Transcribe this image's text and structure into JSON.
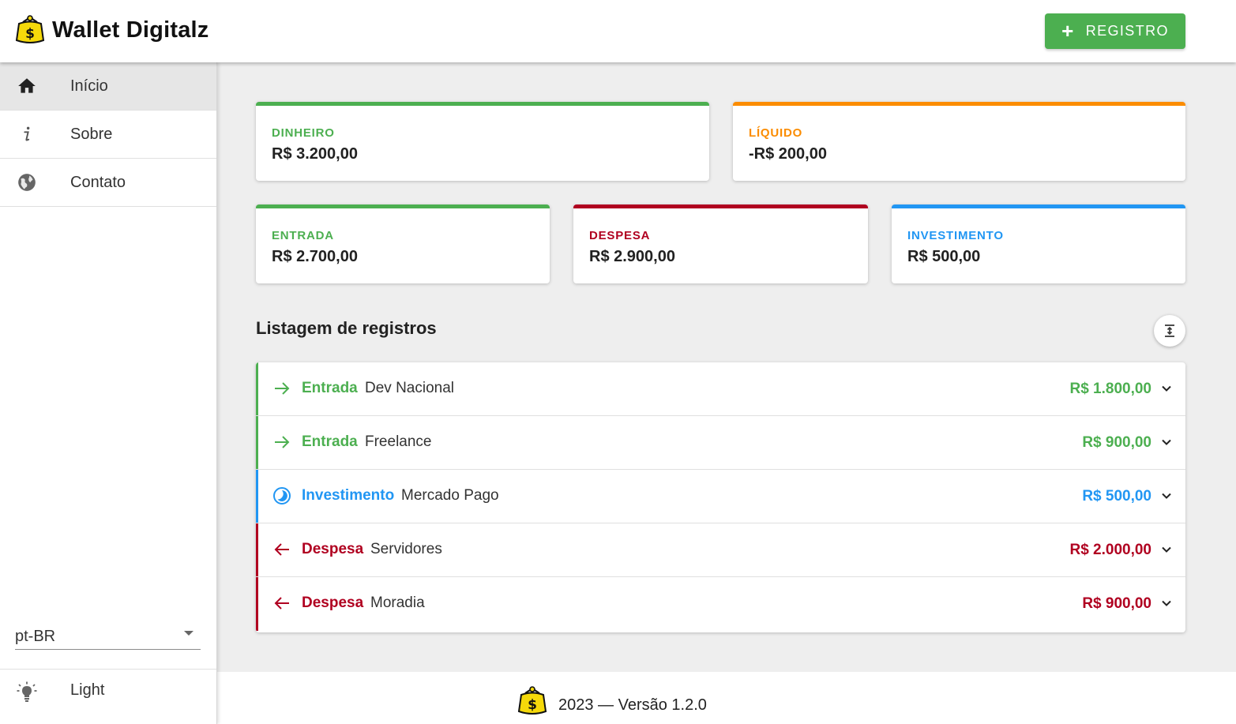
{
  "header": {
    "title": "Wallet Digitalz",
    "logo_icon": "wallet-coin-purse-icon",
    "register_button": {
      "icon": "plus-icon",
      "label": "REGISTRO"
    }
  },
  "sidebar": {
    "items": [
      {
        "icon": "home-icon",
        "label": "Início",
        "active": true
      },
      {
        "icon": "info-icon",
        "label": "Sobre",
        "active": false
      },
      {
        "icon": "globe-icon",
        "label": "Contato",
        "active": false
      }
    ],
    "language": {
      "selected": "pt-BR"
    },
    "theme": {
      "icon": "lightbulb-icon",
      "label": "Light"
    }
  },
  "summary": {
    "dinheiro": {
      "label": "DINHEIRO",
      "value": "R$ 3.200,00",
      "color": "#4caf50"
    },
    "liquido": {
      "label": "LÍQUIDO",
      "value": "-R$ 200,00",
      "color": "#fb8c00"
    },
    "entrada": {
      "label": "ENTRADA",
      "value": "R$ 2.700,00",
      "color": "#4caf50"
    },
    "despesa": {
      "label": "DESPESA",
      "value": "R$ 2.900,00",
      "color": "#b00020"
    },
    "investimento": {
      "label": "INVESTIMENTO",
      "value": "R$ 500,00",
      "color": "#2196f3"
    }
  },
  "records": {
    "title": "Listagem de registros",
    "toggle_icon": "expand-vertical-icon",
    "rows": [
      {
        "type": "Entrada",
        "description": "Dev Nacional",
        "value": "R$ 1.800,00",
        "color": "#4caf50",
        "icon": "arrow-right-icon"
      },
      {
        "type": "Entrada",
        "description": "Freelance",
        "value": "R$ 900,00",
        "color": "#4caf50",
        "icon": "arrow-right-icon"
      },
      {
        "type": "Investimento",
        "description": "Mercado Pago",
        "value": "R$ 500,00",
        "color": "#2196f3",
        "icon": "progress-circle-icon"
      },
      {
        "type": "Despesa",
        "description": "Servidores",
        "value": "R$ 2.000,00",
        "color": "#b00020",
        "icon": "arrow-left-icon"
      },
      {
        "type": "Despesa",
        "description": "Moradia",
        "value": "R$ 900,00",
        "color": "#b00020",
        "icon": "arrow-left-icon"
      }
    ]
  },
  "footer": {
    "text": "2023 — Versão 1.2.0",
    "logo_icon": "wallet-coin-purse-icon"
  }
}
